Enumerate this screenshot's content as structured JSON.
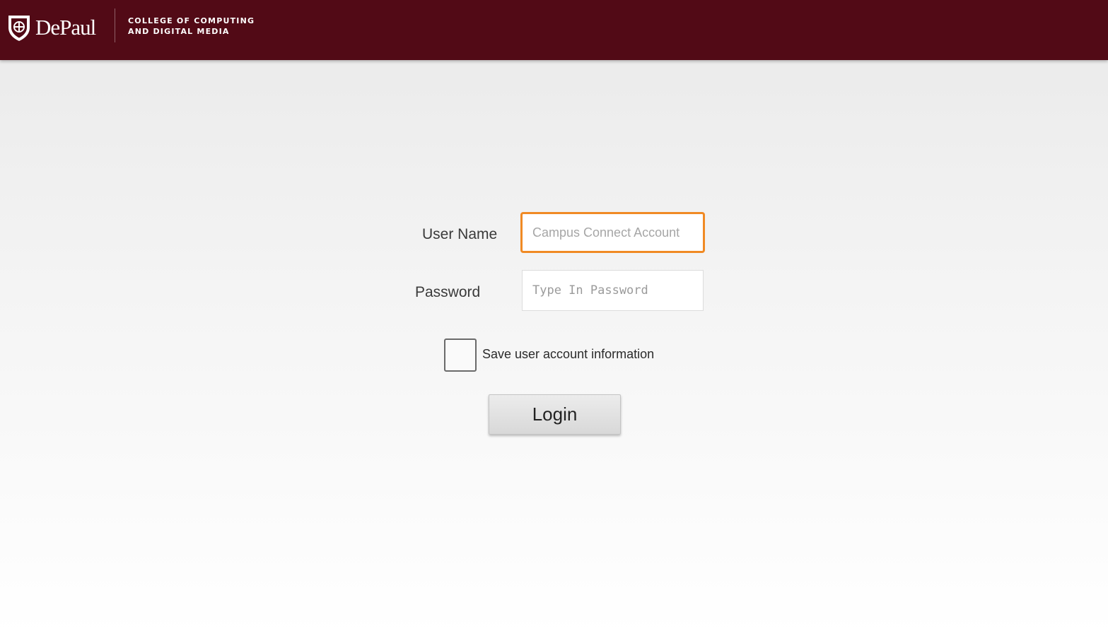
{
  "header": {
    "brand_name": "DePaul",
    "logo_icon": "shield-icon",
    "college_line1": "College of Computing",
    "college_line2": "and Digital Media",
    "background_color": "#520a16"
  },
  "form": {
    "username_label": "User Name",
    "username_placeholder": "Campus Connect Account",
    "username_value": "",
    "username_focus_color": "#f08a24",
    "password_label": "Password",
    "password_placeholder": "Type In Password",
    "password_value": "",
    "save_account_label": "Save user account information",
    "save_account_checked": false,
    "login_button_label": "Login"
  }
}
